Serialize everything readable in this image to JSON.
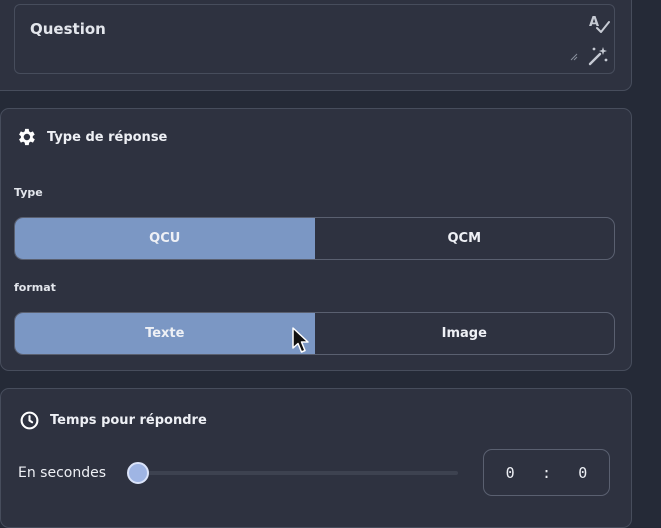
{
  "question": {
    "placeholder": "Question",
    "spellcheck_icon": "spellcheck-icon",
    "magic_icon": "magic-wand-icon"
  },
  "response_type": {
    "title": "Type de réponse",
    "icon": "gear-icon",
    "type_label": "Type",
    "type_options": [
      "QCU",
      "QCM"
    ],
    "type_selected": "QCU",
    "format_label": "format",
    "format_options": [
      "Texte",
      "Image"
    ],
    "format_selected": "Texte"
  },
  "timing": {
    "title": "Temps pour répondre",
    "icon": "clock-icon",
    "seconds_label": "En secondes",
    "slider_value": 0,
    "minutes": "0",
    "separator": ":",
    "seconds": "0"
  },
  "colors": {
    "background": "#252a37",
    "card": "#2e3240",
    "accent": "#7b97c4"
  }
}
